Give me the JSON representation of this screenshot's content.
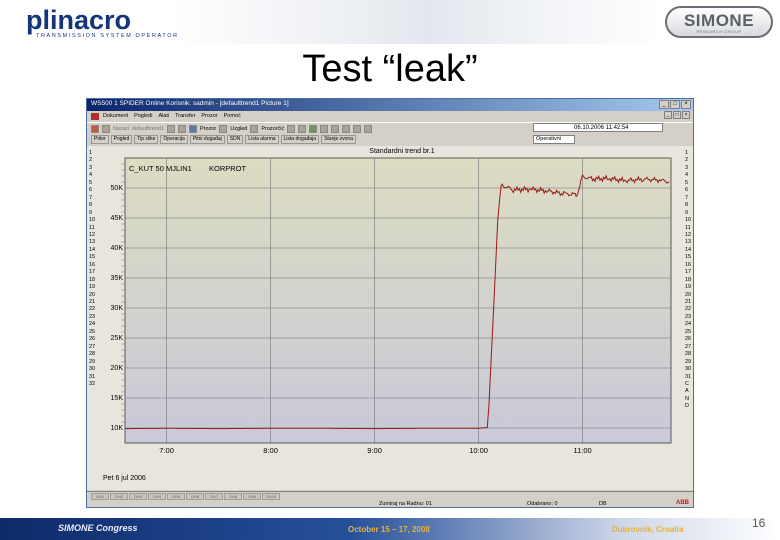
{
  "slide": {
    "logo_left": "plinacro",
    "logo_left_sub": "TRANSMISSION SYSTEM OPERATOR",
    "logo_right": "SIMONE",
    "logo_right_sub": "RESEARCH GROUP",
    "title": "Test “leak”",
    "footer_congress": "SIMONE Congress",
    "footer_date": "October 15 – 17, 2008",
    "footer_place": "Dubrovnik, Croatia",
    "page_number": "16"
  },
  "app": {
    "window_title": "WS500 1 SPIDER Online Korisnik: sadmin - [defaulttrend1 Picture 1]",
    "menu": [
      "Dokument",
      "Pogledi",
      "Alati",
      "Transfer",
      "Prozor",
      "Pomoć"
    ],
    "toolbar1": {
      "labels": [
        "Nazad",
        "defaulttrend1",
        "Prozor",
        "Uzgled",
        "Prozorčić"
      ],
      "date": "06.10.2006 11:42:54"
    },
    "toolbar2": {
      "buttons": [
        "Pittor",
        "Pogled",
        "Tip slike",
        "Operacija",
        "Pitni događaj",
        "SDN",
        "Lista alarma",
        "Lista događaja",
        "Stanje zvona"
      ],
      "select": "Operativni"
    },
    "trend": {
      "title": "Standardni trend br.1",
      "tag": "C_KUT 50 MJLIN1",
      "tag2": "KORPROT",
      "date_label": "Pet 6 jul 2006"
    },
    "row_numbers_left": [
      "1",
      "2",
      "3",
      "4",
      "5",
      "6",
      "7",
      "8",
      "9",
      "10",
      "11",
      "12",
      "13",
      "14",
      "15",
      "16",
      "17",
      "18",
      "19",
      "20",
      "21",
      "22",
      "23",
      "24",
      "25",
      "26",
      "27",
      "28",
      "29",
      "30",
      "31",
      "32"
    ],
    "row_numbers_right": [
      "1",
      "2",
      "3",
      "4",
      "5",
      "6",
      "7",
      "8",
      "9",
      "10",
      "11",
      "12",
      "13",
      "14",
      "15",
      "16",
      "17",
      "18",
      "19",
      "20",
      "21",
      "22",
      "23",
      "24",
      "25",
      "26",
      "27",
      "28",
      "29",
      "30",
      "31",
      "C",
      "A",
      "N",
      "D"
    ],
    "status": {
      "tabs": [
        "OH1",
        "OH2",
        "OH3",
        "OH4",
        "OH5",
        "OH6",
        "OH7",
        "OH8",
        "OH9",
        "OH10"
      ],
      "zoom": "Zumiraj na Radnu: 01",
      "observer": "Odabrano: 0",
      "db": "DB",
      "brand": "ABB"
    }
  },
  "chart_data": {
    "type": "line",
    "title": "Standardni trend br.1",
    "xlabel": "",
    "ylabel": "",
    "x_ticks": [
      "7:00",
      "8:00",
      "9:00",
      "10:00",
      "11:00"
    ],
    "y_ticks": [
      "10K",
      "15K",
      "20K",
      "25K",
      "30K",
      "35K",
      "40K",
      "45K",
      "50K"
    ],
    "ylim": [
      7500,
      55000
    ],
    "xlim_hours": [
      6.6,
      11.85
    ],
    "grid": true,
    "color": "#9a1818",
    "series": [
      {
        "name": "C_KUT 50 MJLIN1",
        "x": [
          "6:36",
          "7:00",
          "7:30",
          "8:00",
          "8:30",
          "9:00",
          "9:30",
          "10:00",
          "10:05",
          "10:06",
          "10:07",
          "10:08",
          "10:09",
          "10:10",
          "10:11",
          "10:13",
          "10:15",
          "10:20",
          "10:30",
          "10:40",
          "10:50",
          "10:57",
          "10:59",
          "11:00",
          "11:05",
          "11:15",
          "11:25",
          "11:35",
          "11:45",
          "11:50"
        ],
        "values": [
          9900,
          9950,
          9900,
          9950,
          9950,
          9900,
          9950,
          9950,
          10100,
          14000,
          20000,
          26000,
          32000,
          38000,
          44500,
          50800,
          50300,
          49700,
          49800,
          49500,
          49000,
          48900,
          50900,
          51900,
          51500,
          51600,
          51200,
          51500,
          51300,
          51000
        ]
      }
    ]
  }
}
